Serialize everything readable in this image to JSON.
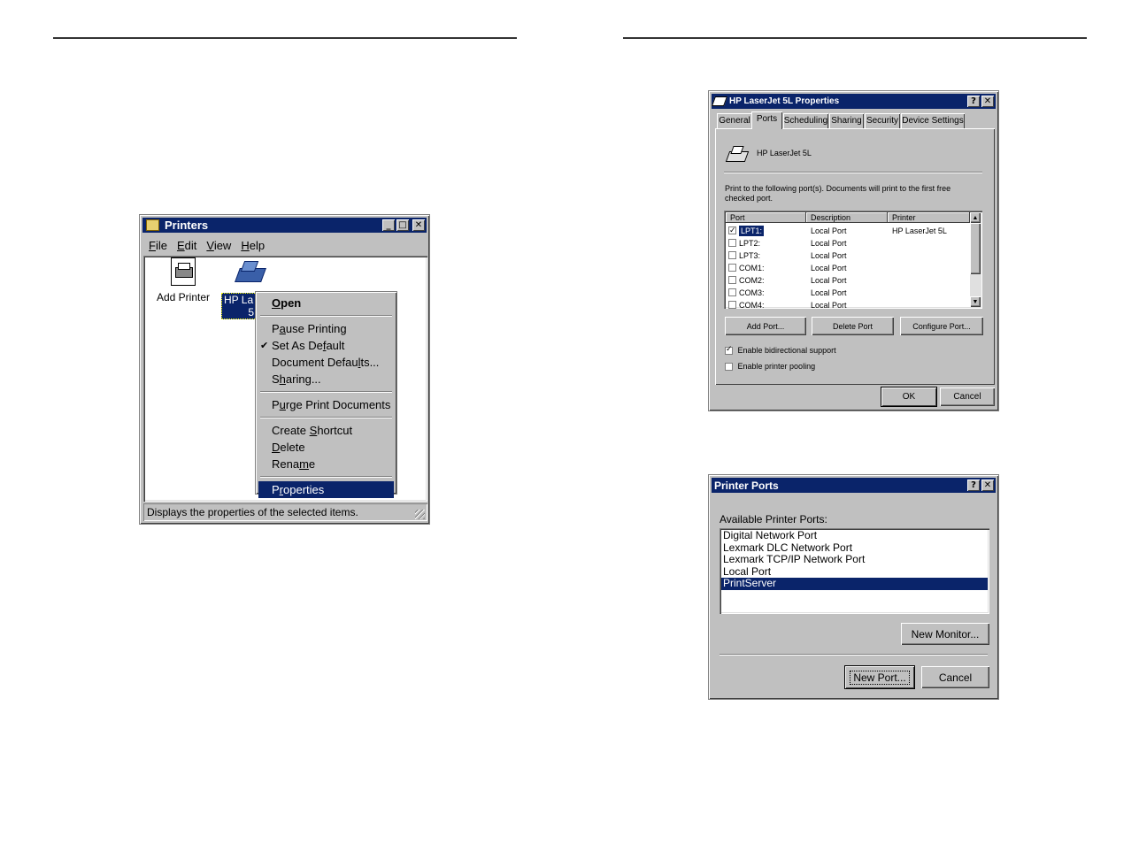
{
  "printers_window": {
    "title": "Printers",
    "menu": [
      "File",
      "Edit",
      "View",
      "Help"
    ],
    "menu_accel": [
      0,
      0,
      0,
      0
    ],
    "icons": [
      {
        "label": "Add Printer",
        "icon": "add-printer-icon"
      },
      {
        "label_line1": "HP La",
        "label_line2": "5",
        "icon": "printer-icon",
        "selected": true
      }
    ],
    "status": "Displays the properties of the selected items."
  },
  "context_menu": {
    "groups": [
      [
        {
          "label": "Open",
          "accel": 0,
          "bold": true
        }
      ],
      [
        {
          "label": "Pause Printing",
          "accel": 1
        },
        {
          "label": "Set As Default",
          "accel": 9,
          "checked": true
        },
        {
          "label": "Document Defaults...",
          "accel": 14
        },
        {
          "label": "Sharing...",
          "accel": 1
        }
      ],
      [
        {
          "label": "Purge Print Documents",
          "accel": 1
        }
      ],
      [
        {
          "label": "Create Shortcut",
          "accel": 7
        },
        {
          "label": "Delete",
          "accel": 0
        },
        {
          "label": "Rename",
          "accel": 4
        }
      ],
      [
        {
          "label": "Properties",
          "accel": 1,
          "selected": true
        }
      ]
    ]
  },
  "properties_dialog": {
    "title": "HP LaserJet 5L Properties",
    "tabs": [
      "General",
      "Ports",
      "Scheduling",
      "Sharing",
      "Security",
      "Device Settings"
    ],
    "active_tab": "Ports",
    "printer_name": "HP LaserJet 5L",
    "instruction": "Print to the following port(s). Documents will print to the first free checked port.",
    "columns": [
      "Port",
      "Description",
      "Printer"
    ],
    "rows": [
      {
        "port": "LPT1:",
        "desc": "Local Port",
        "printer": "HP LaserJet 5L",
        "checked": true
      },
      {
        "port": "LPT2:",
        "desc": "Local Port",
        "printer": "",
        "checked": false
      },
      {
        "port": "LPT3:",
        "desc": "Local Port",
        "printer": "",
        "checked": false
      },
      {
        "port": "COM1:",
        "desc": "Local Port",
        "printer": "",
        "checked": false
      },
      {
        "port": "COM2:",
        "desc": "Local Port",
        "printer": "",
        "checked": false
      },
      {
        "port": "COM3:",
        "desc": "Local Port",
        "printer": "",
        "checked": false
      },
      {
        "port": "COM4:",
        "desc": "Local Port",
        "printer": "",
        "checked": false
      }
    ],
    "add_port": "Add Port...",
    "delete_port": "Delete Port",
    "configure_port": "Configure Port...",
    "bidirectional": "Enable bidirectional support",
    "bidirectional_checked": true,
    "pooling": "Enable printer pooling",
    "pooling_checked": false,
    "ok": "OK",
    "cancel": "Cancel"
  },
  "printer_ports_dialog": {
    "title": "Printer Ports",
    "label": "Available Printer Ports:",
    "ports": [
      "Digital Network Port",
      "Lexmark DLC Network Port",
      "Lexmark TCP/IP Network Port",
      "Local Port",
      "PrintServer"
    ],
    "selected_index": 4,
    "new_monitor": "New Monitor...",
    "new_port": "New Port...",
    "cancel": "Cancel"
  },
  "colors": {
    "titlebar": "#0a246a",
    "face": "#c0c0c0",
    "selection": "#0a246a"
  }
}
